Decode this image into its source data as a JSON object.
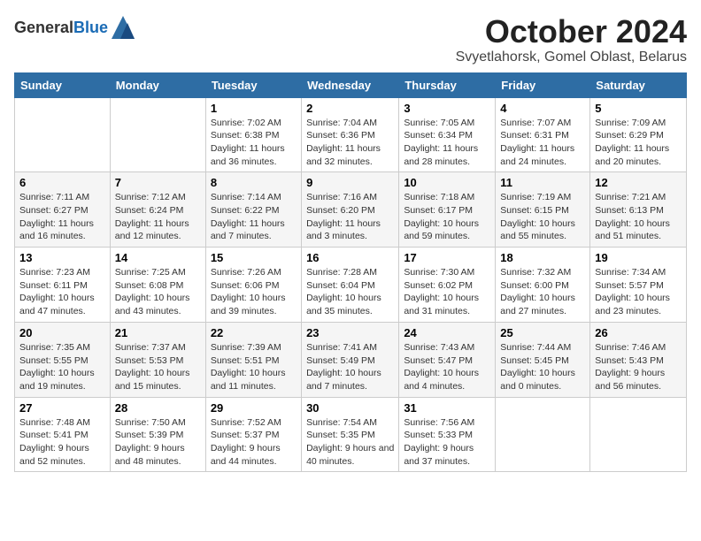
{
  "header": {
    "logo_general": "General",
    "logo_blue": "Blue",
    "month": "October 2024",
    "location": "Svyetlahorsk, Gomel Oblast, Belarus"
  },
  "days_of_week": [
    "Sunday",
    "Monday",
    "Tuesday",
    "Wednesday",
    "Thursday",
    "Friday",
    "Saturday"
  ],
  "weeks": [
    [
      {
        "day": "",
        "sunrise": "",
        "sunset": "",
        "daylight": ""
      },
      {
        "day": "",
        "sunrise": "",
        "sunset": "",
        "daylight": ""
      },
      {
        "day": "1",
        "sunrise": "Sunrise: 7:02 AM",
        "sunset": "Sunset: 6:38 PM",
        "daylight": "Daylight: 11 hours and 36 minutes."
      },
      {
        "day": "2",
        "sunrise": "Sunrise: 7:04 AM",
        "sunset": "Sunset: 6:36 PM",
        "daylight": "Daylight: 11 hours and 32 minutes."
      },
      {
        "day": "3",
        "sunrise": "Sunrise: 7:05 AM",
        "sunset": "Sunset: 6:34 PM",
        "daylight": "Daylight: 11 hours and 28 minutes."
      },
      {
        "day": "4",
        "sunrise": "Sunrise: 7:07 AM",
        "sunset": "Sunset: 6:31 PM",
        "daylight": "Daylight: 11 hours and 24 minutes."
      },
      {
        "day": "5",
        "sunrise": "Sunrise: 7:09 AM",
        "sunset": "Sunset: 6:29 PM",
        "daylight": "Daylight: 11 hours and 20 minutes."
      }
    ],
    [
      {
        "day": "6",
        "sunrise": "Sunrise: 7:11 AM",
        "sunset": "Sunset: 6:27 PM",
        "daylight": "Daylight: 11 hours and 16 minutes."
      },
      {
        "day": "7",
        "sunrise": "Sunrise: 7:12 AM",
        "sunset": "Sunset: 6:24 PM",
        "daylight": "Daylight: 11 hours and 12 minutes."
      },
      {
        "day": "8",
        "sunrise": "Sunrise: 7:14 AM",
        "sunset": "Sunset: 6:22 PM",
        "daylight": "Daylight: 11 hours and 7 minutes."
      },
      {
        "day": "9",
        "sunrise": "Sunrise: 7:16 AM",
        "sunset": "Sunset: 6:20 PM",
        "daylight": "Daylight: 11 hours and 3 minutes."
      },
      {
        "day": "10",
        "sunrise": "Sunrise: 7:18 AM",
        "sunset": "Sunset: 6:17 PM",
        "daylight": "Daylight: 10 hours and 59 minutes."
      },
      {
        "day": "11",
        "sunrise": "Sunrise: 7:19 AM",
        "sunset": "Sunset: 6:15 PM",
        "daylight": "Daylight: 10 hours and 55 minutes."
      },
      {
        "day": "12",
        "sunrise": "Sunrise: 7:21 AM",
        "sunset": "Sunset: 6:13 PM",
        "daylight": "Daylight: 10 hours and 51 minutes."
      }
    ],
    [
      {
        "day": "13",
        "sunrise": "Sunrise: 7:23 AM",
        "sunset": "Sunset: 6:11 PM",
        "daylight": "Daylight: 10 hours and 47 minutes."
      },
      {
        "day": "14",
        "sunrise": "Sunrise: 7:25 AM",
        "sunset": "Sunset: 6:08 PM",
        "daylight": "Daylight: 10 hours and 43 minutes."
      },
      {
        "day": "15",
        "sunrise": "Sunrise: 7:26 AM",
        "sunset": "Sunset: 6:06 PM",
        "daylight": "Daylight: 10 hours and 39 minutes."
      },
      {
        "day": "16",
        "sunrise": "Sunrise: 7:28 AM",
        "sunset": "Sunset: 6:04 PM",
        "daylight": "Daylight: 10 hours and 35 minutes."
      },
      {
        "day": "17",
        "sunrise": "Sunrise: 7:30 AM",
        "sunset": "Sunset: 6:02 PM",
        "daylight": "Daylight: 10 hours and 31 minutes."
      },
      {
        "day": "18",
        "sunrise": "Sunrise: 7:32 AM",
        "sunset": "Sunset: 6:00 PM",
        "daylight": "Daylight: 10 hours and 27 minutes."
      },
      {
        "day": "19",
        "sunrise": "Sunrise: 7:34 AM",
        "sunset": "Sunset: 5:57 PM",
        "daylight": "Daylight: 10 hours and 23 minutes."
      }
    ],
    [
      {
        "day": "20",
        "sunrise": "Sunrise: 7:35 AM",
        "sunset": "Sunset: 5:55 PM",
        "daylight": "Daylight: 10 hours and 19 minutes."
      },
      {
        "day": "21",
        "sunrise": "Sunrise: 7:37 AM",
        "sunset": "Sunset: 5:53 PM",
        "daylight": "Daylight: 10 hours and 15 minutes."
      },
      {
        "day": "22",
        "sunrise": "Sunrise: 7:39 AM",
        "sunset": "Sunset: 5:51 PM",
        "daylight": "Daylight: 10 hours and 11 minutes."
      },
      {
        "day": "23",
        "sunrise": "Sunrise: 7:41 AM",
        "sunset": "Sunset: 5:49 PM",
        "daylight": "Daylight: 10 hours and 7 minutes."
      },
      {
        "day": "24",
        "sunrise": "Sunrise: 7:43 AM",
        "sunset": "Sunset: 5:47 PM",
        "daylight": "Daylight: 10 hours and 4 minutes."
      },
      {
        "day": "25",
        "sunrise": "Sunrise: 7:44 AM",
        "sunset": "Sunset: 5:45 PM",
        "daylight": "Daylight: 10 hours and 0 minutes."
      },
      {
        "day": "26",
        "sunrise": "Sunrise: 7:46 AM",
        "sunset": "Sunset: 5:43 PM",
        "daylight": "Daylight: 9 hours and 56 minutes."
      }
    ],
    [
      {
        "day": "27",
        "sunrise": "Sunrise: 7:48 AM",
        "sunset": "Sunset: 5:41 PM",
        "daylight": "Daylight: 9 hours and 52 minutes."
      },
      {
        "day": "28",
        "sunrise": "Sunrise: 7:50 AM",
        "sunset": "Sunset: 5:39 PM",
        "daylight": "Daylight: 9 hours and 48 minutes."
      },
      {
        "day": "29",
        "sunrise": "Sunrise: 7:52 AM",
        "sunset": "Sunset: 5:37 PM",
        "daylight": "Daylight: 9 hours and 44 minutes."
      },
      {
        "day": "30",
        "sunrise": "Sunrise: 7:54 AM",
        "sunset": "Sunset: 5:35 PM",
        "daylight": "Daylight: 9 hours and 40 minutes."
      },
      {
        "day": "31",
        "sunrise": "Sunrise: 7:56 AM",
        "sunset": "Sunset: 5:33 PM",
        "daylight": "Daylight: 9 hours and 37 minutes."
      },
      {
        "day": "",
        "sunrise": "",
        "sunset": "",
        "daylight": ""
      },
      {
        "day": "",
        "sunrise": "",
        "sunset": "",
        "daylight": ""
      }
    ]
  ]
}
